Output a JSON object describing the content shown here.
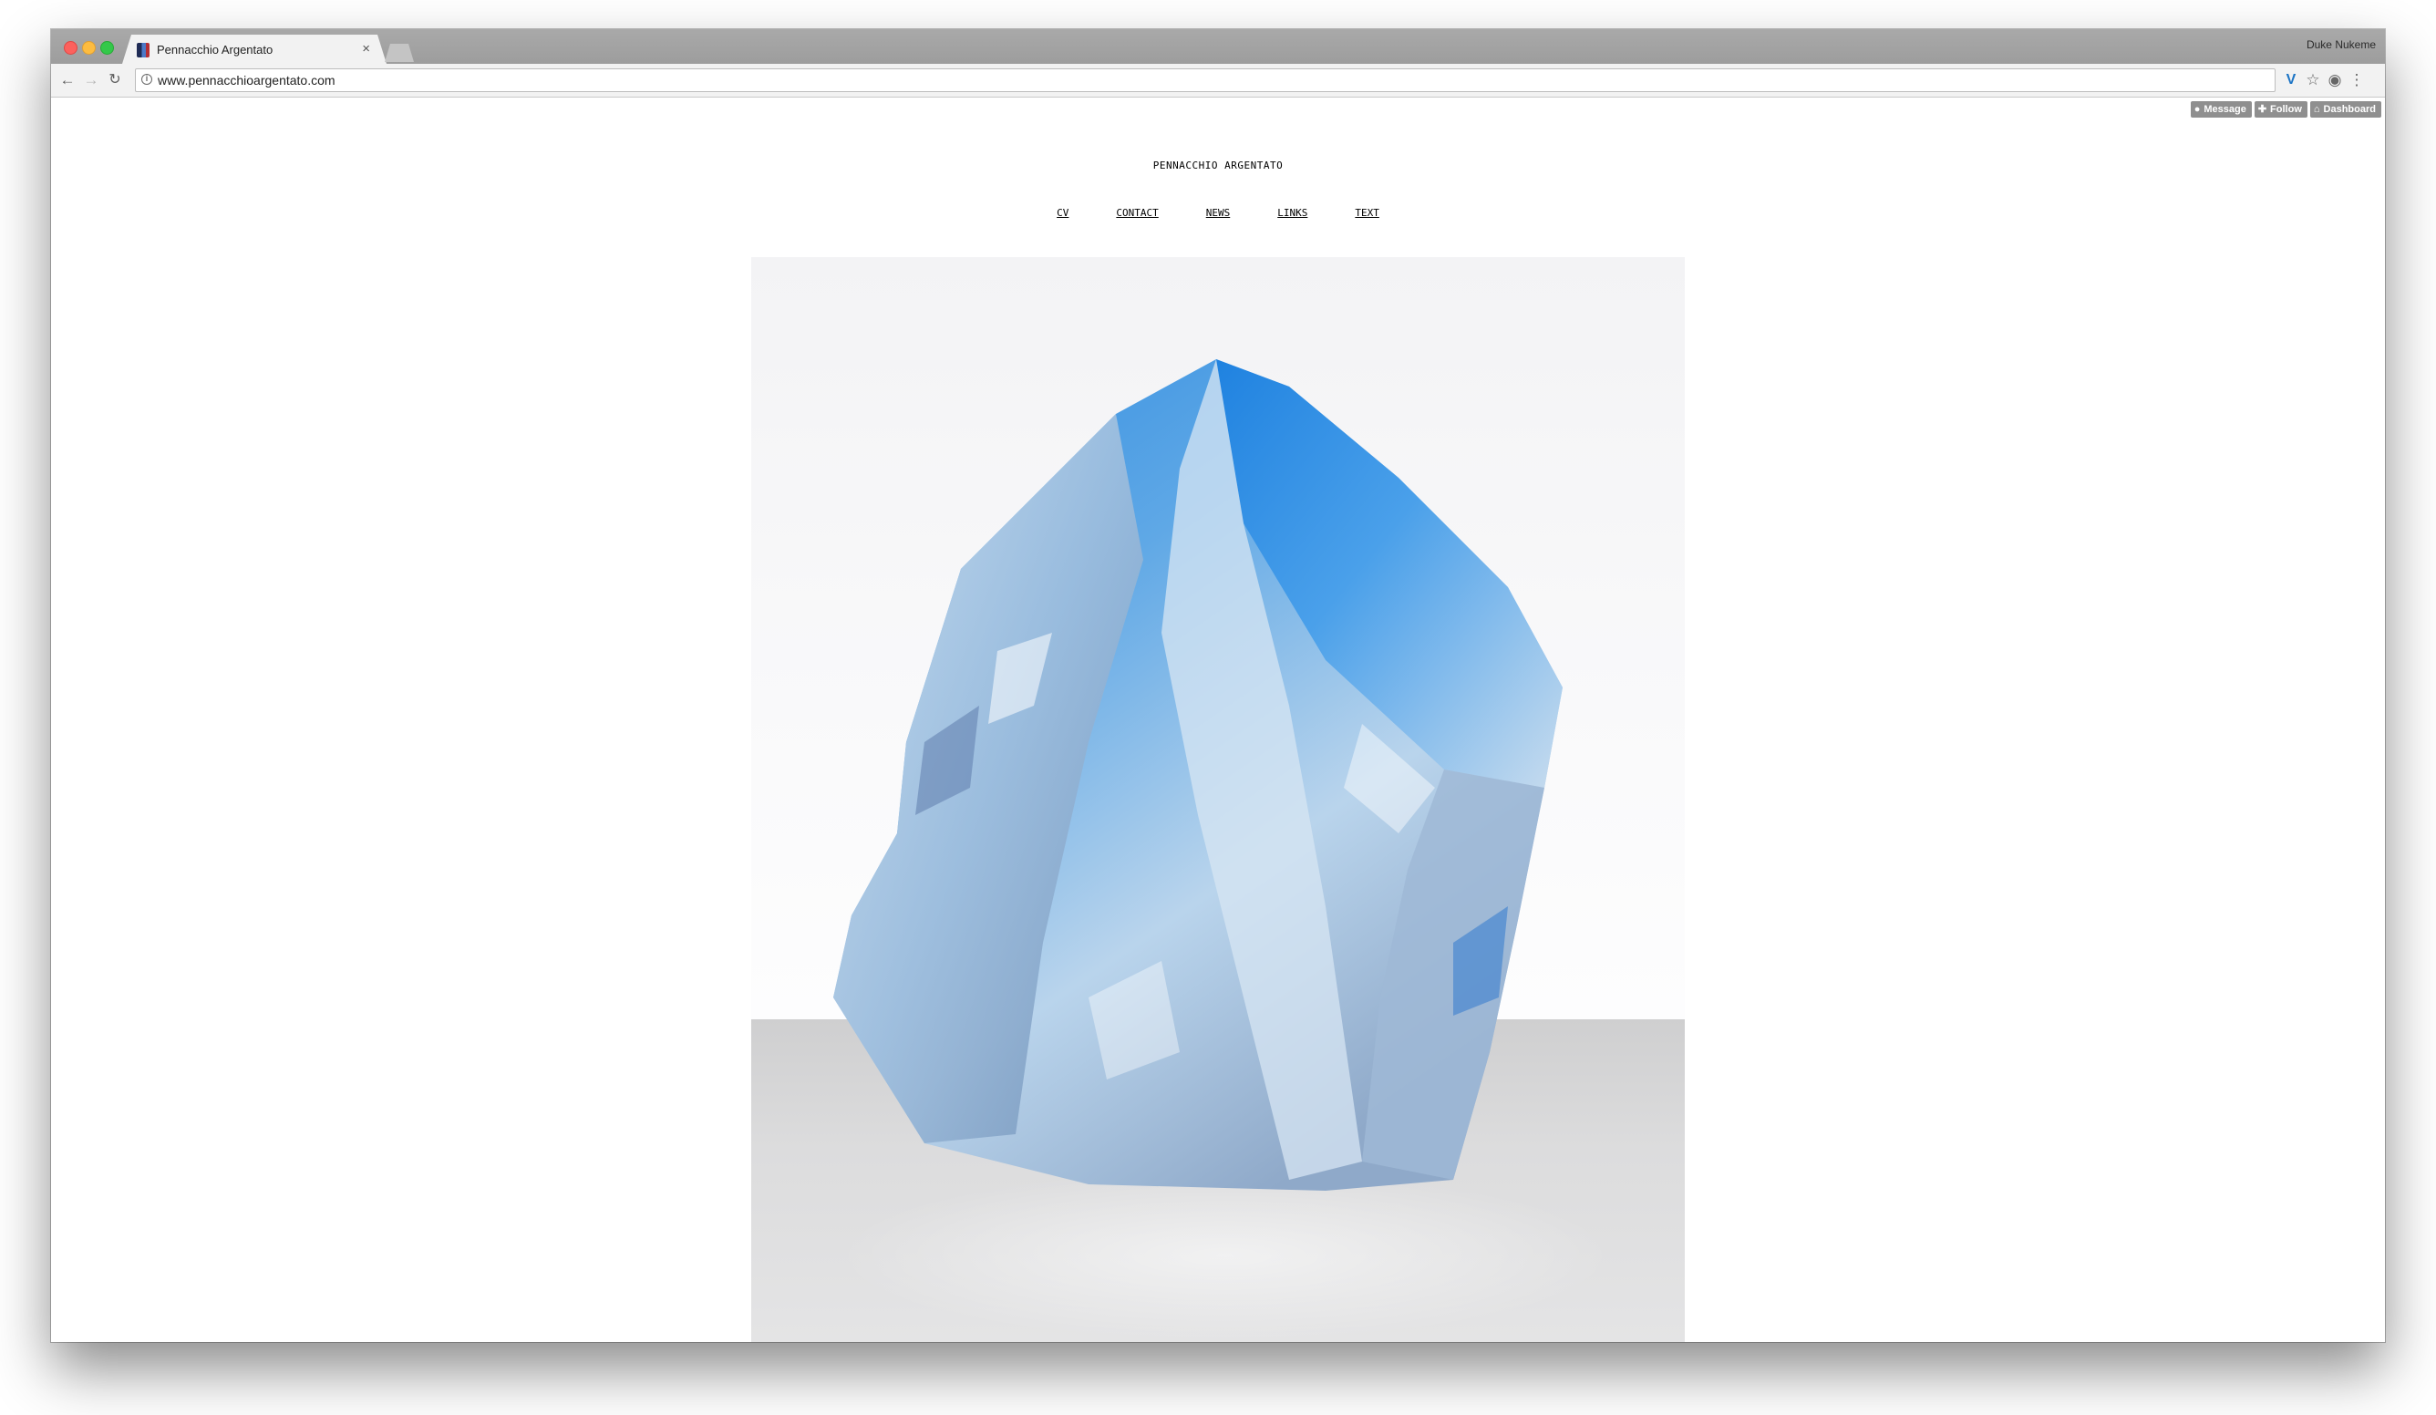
{
  "browser": {
    "tab_title": "Pennacchio Argentato",
    "tab_close": "×",
    "profile_name": "Duke Nukeme",
    "url": "www.pennacchioargentato.com",
    "icons": [
      "back-arrow-icon",
      "forward-arrow-icon",
      "reload-icon",
      "info-icon",
      "vimeo-extension-icon",
      "star-icon",
      "shield-extension-icon",
      "menu-dots-icon"
    ]
  },
  "tumblr_controls": {
    "message": "Message",
    "follow": "Follow",
    "dashboard": "Dashboard"
  },
  "site": {
    "title": "PENNACCHIO ARGENTATO",
    "nav": [
      "CV",
      "CONTACT",
      "NEWS",
      "LINKS",
      "TEXT"
    ]
  },
  "colors": {
    "ice_blue": "#2f8fe0",
    "ice_light": "#cfe3f3",
    "floor": "#d6d6d7"
  }
}
